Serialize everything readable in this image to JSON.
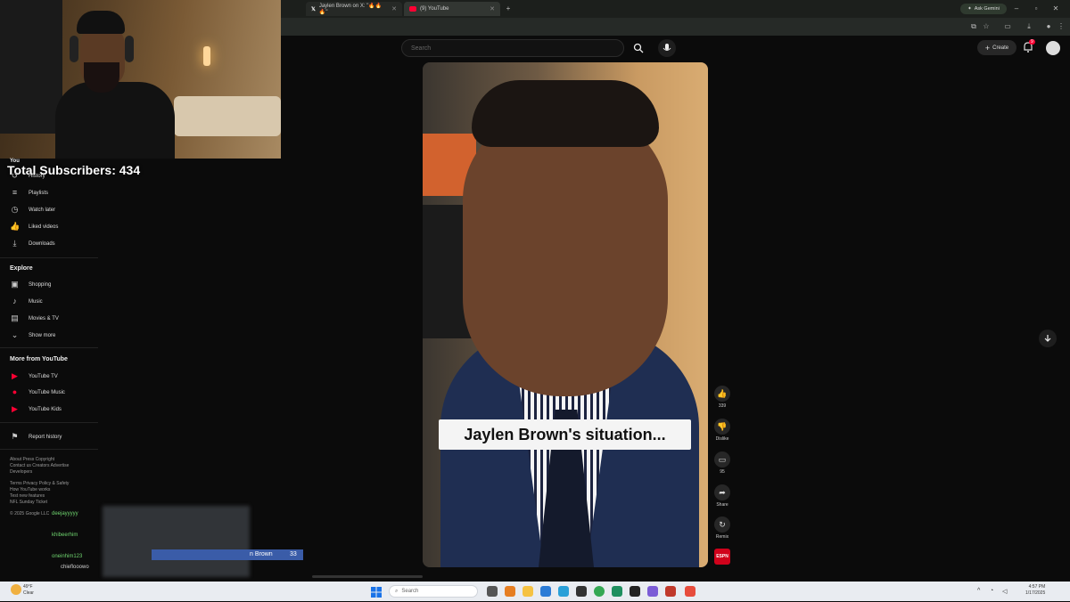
{
  "browser": {
    "tabs": [
      {
        "label": "Jaylen Brown on X: \"🔥🔥🔥\"",
        "icon": "x-logo-icon"
      },
      {
        "label": "(9) YouTube",
        "icon": "youtube-logo-icon"
      }
    ],
    "new_tab": "+",
    "ask_button": "Ask Gemini"
  },
  "youtube": {
    "search_placeholder": "Search",
    "create_label": "Create",
    "notification_count": "9"
  },
  "stream": {
    "total_subscribers_label": "Total Subscribers: 434"
  },
  "sidebar": {
    "you_label": "You",
    "you_items": [
      {
        "label": "History",
        "icon": "history-icon"
      },
      {
        "label": "Playlists",
        "icon": "playlist-icon"
      },
      {
        "label": "Watch later",
        "icon": "clock-icon"
      },
      {
        "label": "Liked videos",
        "icon": "thumbs-up-icon"
      },
      {
        "label": "Downloads",
        "icon": "download-icon"
      }
    ],
    "explore_label": "Explore",
    "explore_items": [
      {
        "label": "Shopping",
        "icon": "shopping-bag-icon"
      },
      {
        "label": "Music",
        "icon": "music-note-icon"
      },
      {
        "label": "Movies & TV",
        "icon": "film-icon"
      },
      {
        "label": "Show more",
        "icon": "chevron-down-icon"
      }
    ],
    "more_label": "More from YouTube",
    "more_items": [
      {
        "label": "YouTube TV",
        "icon": "youtube-tv-icon"
      },
      {
        "label": "YouTube Music",
        "icon": "youtube-music-icon"
      },
      {
        "label": "YouTube Kids",
        "icon": "youtube-kids-icon"
      }
    ],
    "report_label": "Report history",
    "footer_lines": [
      "About  Press  Copyright",
      "Contact us  Creators  Advertise",
      "Developers",
      "",
      "Terms  Privacy  Policy & Safety",
      "How YouTube works",
      "Test new features",
      "NFL Sunday Ticket",
      "",
      "© 2025 Google LLC"
    ]
  },
  "short": {
    "caption": "Jaylen Brown's situation...",
    "actions": [
      {
        "label": "339",
        "icon": "like-icon"
      },
      {
        "label": "Dislike",
        "icon": "dislike-icon"
      },
      {
        "label": "95",
        "icon": "comment-icon"
      },
      {
        "label": "Share",
        "icon": "share-icon"
      },
      {
        "label": "Remix",
        "icon": "remix-icon"
      },
      {
        "label": "ESPN",
        "icon": "channel-avatar-icon"
      }
    ]
  },
  "chat": {
    "users": [
      "deejayyyyy",
      "khibeerhim",
      "oneinhim123",
      "chieflooowo",
      "prowlufen"
    ],
    "highlight_text": "n Brown",
    "highlight_count": "33"
  },
  "taskbar": {
    "weather_temp": "49°F",
    "weather_desc": "Clear",
    "search_placeholder": "Search",
    "time": "4:57 PM",
    "date": "1/17/2025"
  },
  "colors": {
    "youtube_red": "#ff0033",
    "chat_green": "#6fd46f",
    "highlight_blue": "#3a5ca8"
  }
}
